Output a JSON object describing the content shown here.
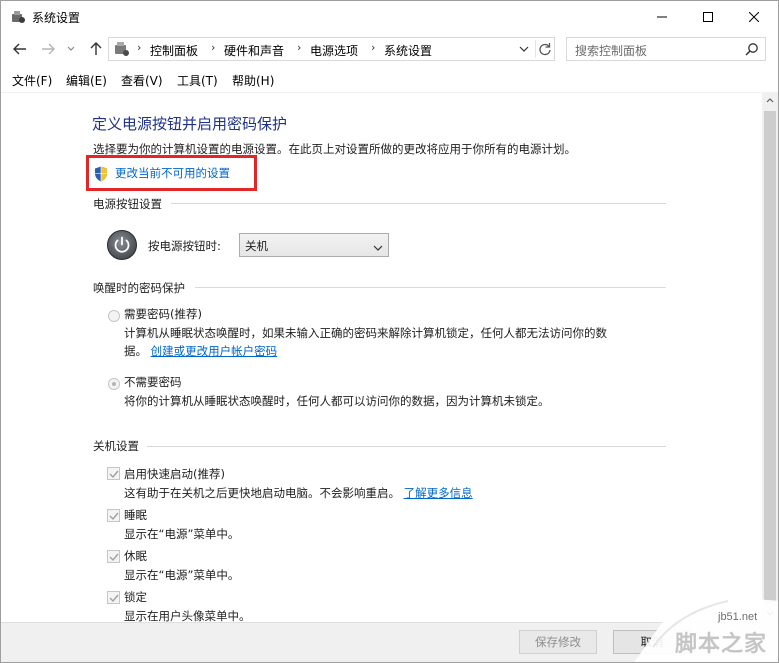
{
  "window": {
    "title": "系统设置"
  },
  "nav": {
    "breadcrumbs": [
      "控制面板",
      "硬件和声音",
      "电源选项",
      "系统设置"
    ],
    "search_placeholder": "搜索控制面板"
  },
  "menu": [
    "文件(F)",
    "编辑(E)",
    "查看(V)",
    "工具(T)",
    "帮助(H)"
  ],
  "page": {
    "title": "定义电源按钮并启用密码保护",
    "description": "选择要为你的计算机设置的电源设置。在此页上对设置所做的更改将应用于你所有的电源计划。",
    "change_link": "更改当前不可用的设置"
  },
  "power_buttons": {
    "section_title": "电源按钮设置",
    "label": "按电源按钮时:",
    "selected": "关机"
  },
  "wake_password": {
    "section_title": "唤醒时的密码保护",
    "options": [
      {
        "label": "需要密码(推荐)",
        "checked": false,
        "desc_line1": "计算机从睡眠状态唤醒时，如果未输入正确的密码来解除计算机锁定，任何人都无法访问你的数",
        "desc_line2_prefix": "据。",
        "desc_link": "创建或更改用户帐户密码"
      },
      {
        "label": "不需要密码",
        "checked": true,
        "desc_line1": "将你的计算机从睡眠状态唤醒时，任何人都可以访问你的数据，因为计算机未锁定。"
      }
    ]
  },
  "shutdown": {
    "section_title": "关机设置",
    "items": [
      {
        "label": "启用快速启动(推荐)",
        "checked": true,
        "desc": "这有助于在关机之后更快地启动电脑。不会影响重启。",
        "desc_link": "了解更多信息"
      },
      {
        "label": "睡眠",
        "checked": true,
        "desc": "显示在“电源”菜单中。"
      },
      {
        "label": "休眠",
        "checked": true,
        "desc": "显示在“电源”菜单中。"
      },
      {
        "label": "锁定",
        "checked": true,
        "desc": "显示在用户头像菜单中。"
      }
    ]
  },
  "footer": {
    "save_label": "保存修改",
    "cancel_label": "取消"
  },
  "watermark": {
    "site": "jb51.net",
    "name": "脚本之家"
  },
  "colors": {
    "title_blue": "#1e3287",
    "link_blue": "#0066cc",
    "highlight_red": "#e32626"
  }
}
